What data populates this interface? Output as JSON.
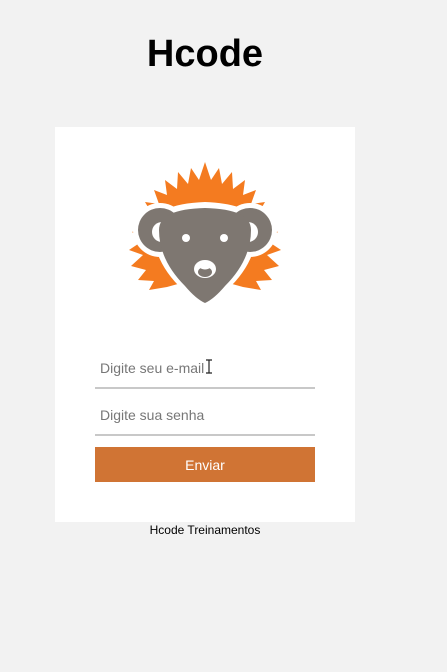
{
  "header": {
    "title": "Hcode"
  },
  "logo": {
    "icon": "hedgehog-logo-icon",
    "spikes_color": "#f47b20",
    "face_color": "#7e7771"
  },
  "form": {
    "email_placeholder": "Digite seu e-mail",
    "password_placeholder": "Digite sua senha",
    "submit_label": "Enviar",
    "submit_color": "#d07434"
  },
  "footer": {
    "text": "Hcode Treinamentos"
  }
}
